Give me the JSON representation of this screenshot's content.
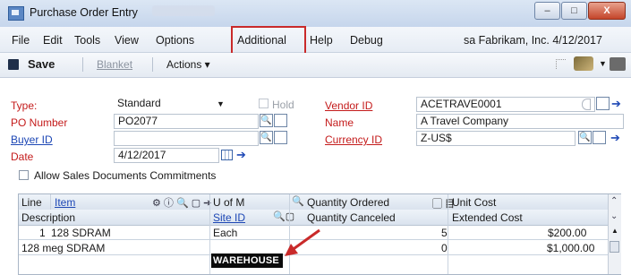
{
  "window": {
    "title": "Purchase Order Entry",
    "min": "–",
    "max": "□",
    "close": "X"
  },
  "menu": {
    "items": [
      "File",
      "Edit",
      "Tools",
      "View",
      "Options",
      "Additional",
      "Help",
      "Debug"
    ],
    "context": "sa  Fabrikam, Inc.  4/12/2017"
  },
  "toolbar": {
    "save": "Save",
    "blanket": "Blanket",
    "actions": "Actions ▾"
  },
  "form": {
    "type_label": "Type:",
    "type_value": "Standard",
    "hold_label": "Hold",
    "po_label": "PO Number",
    "po_value": "PO2077",
    "buyer_label": "Buyer ID",
    "buyer_value": "",
    "date_label": "Date",
    "date_value": "4/12/2017",
    "vendor_label": "Vendor ID",
    "vendor_value": "ACETRAVE0001",
    "name_label": "Name",
    "name_value": "A Travel Company",
    "currency_label": "Currency ID",
    "currency_value": "Z-US$",
    "allow_label": "Allow Sales Documents Commitments"
  },
  "grid": {
    "head1": {
      "line": "Line",
      "item": "Item",
      "uom": "U of M",
      "qty_ordered": "Quantity Ordered",
      "unit_cost": "Unit Cost"
    },
    "head2": {
      "description": "Description",
      "site": "Site ID",
      "qty_canceled": "Quantity Canceled",
      "ext_cost": "Extended Cost"
    },
    "row1": {
      "line": "1",
      "item": "128 SDRAM",
      "uom": "Each",
      "qty": "5",
      "unit_cost": "$200.00"
    },
    "row2": {
      "description": "128 meg SDRAM",
      "site": "WAREHOUSE",
      "qty_canceled": "0",
      "ext_cost": "$1,000.00"
    }
  },
  "colors": {
    "required": "#c41b1b",
    "link": "#1d47b5",
    "highlight_box": "#c92a2a"
  }
}
